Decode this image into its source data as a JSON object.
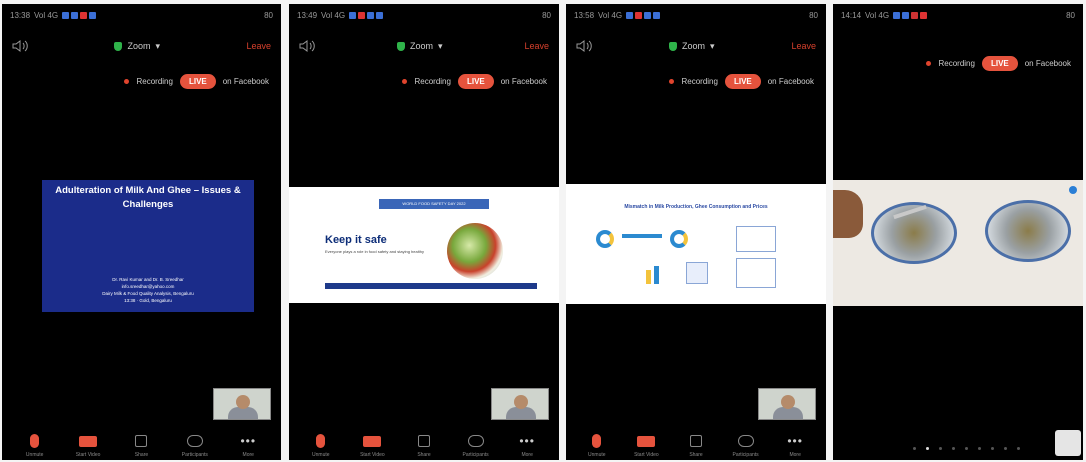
{
  "phones": [
    {
      "status_time": "13:38",
      "signal": "Vol 4G",
      "battery": "80",
      "meeting_title": "Zoom",
      "leave_label": "Leave",
      "recording_label": "Recording",
      "live_label": "LIVE",
      "live_on_label": "on Facebook",
      "slide": {
        "title": "Adulteration of Milk And Ghee – Issues & Challenges",
        "authors": "Dr. Ravi Kumar and Dr. B. Sreedhar",
        "email": "info.sreedhar@yahoo.com",
        "org": "Dairy Milk & Food Quality Analysis, Bengaluru",
        "footer": "13:38 · Gold, Bengaluru"
      },
      "toolbar": [
        "Unmute",
        "Start Video",
        "Share",
        "Participants",
        "More"
      ]
    },
    {
      "status_time": "13:49",
      "signal": "Vol 4G",
      "battery": "80",
      "meeting_title": "Zoom",
      "leave_label": "Leave",
      "recording_label": "Recording",
      "live_label": "LIVE",
      "live_on_label": "on Facebook",
      "slide": {
        "banner": "WORLD FOOD SAFETY DAY 2022",
        "title": "Keep it safe",
        "subtitle": "Everyone plays a role in food safety and staying healthy"
      },
      "toolbar": [
        "Unmute",
        "Start Video",
        "Share",
        "Participants",
        "More"
      ]
    },
    {
      "status_time": "13:58",
      "signal": "Vol 4G",
      "battery": "80",
      "meeting_title": "Zoom",
      "leave_label": "Leave",
      "recording_label": "Recording",
      "live_label": "LIVE",
      "live_on_label": "on Facebook",
      "slide": {
        "title": "Mismatch in Milk Production, Ghee Consumption and Prices"
      },
      "toolbar": [
        "Unmute",
        "Start Video",
        "Share",
        "Participants",
        "More"
      ]
    },
    {
      "status_time": "14:14",
      "signal": "Vol 4G",
      "battery": "80",
      "recording_label": "Recording",
      "live_label": "LIVE",
      "live_on_label": "on Facebook",
      "page_count": 9,
      "page_current": 2
    }
  ],
  "colors": {
    "accent_red": "#e5533d",
    "slide_blue": "#1b2c8a",
    "secure_green": "#2fb34a"
  }
}
